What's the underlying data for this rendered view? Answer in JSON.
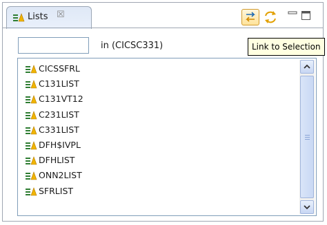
{
  "view": {
    "tab_title": "Lists",
    "tab_icon": "list-icon",
    "close_glyph": "☒",
    "colors": {
      "selected_tool": "#ffe39b",
      "tooltip_bg": "#ffffe1",
      "tab_bg": "#dfe8f6"
    }
  },
  "toolbar": {
    "link_icon": "link-to-selection-icon",
    "sync_icon": "sync-icon",
    "minimize_icon": "minimize-icon",
    "maximize_icon": "maximize-icon",
    "tooltip": "Link to Selection"
  },
  "filter": {
    "value": "",
    "in_text": "in (CICSC331)"
  },
  "lists": {
    "items": [
      {
        "label": "CICSSFRL"
      },
      {
        "label": "C131LIST"
      },
      {
        "label": "C131VT12"
      },
      {
        "label": "C231LIST"
      },
      {
        "label": "C331LIST"
      },
      {
        "label": "DFH$IVPL"
      },
      {
        "label": "DFHLIST"
      },
      {
        "label": "ONN2LIST"
      },
      {
        "label": "SFRLIST"
      }
    ]
  }
}
